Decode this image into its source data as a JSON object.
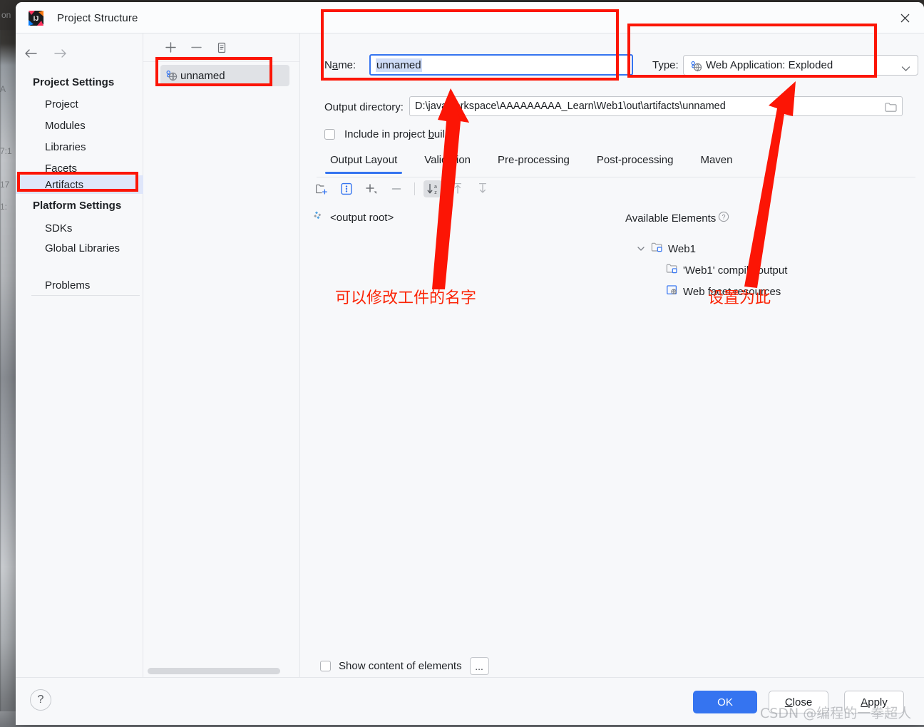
{
  "window": {
    "title": "Project Structure",
    "close_label": "✕"
  },
  "sidebar": {
    "nav_back": "back-arrow",
    "nav_forward": "forward-arrow",
    "groups": [
      {
        "header": "Project Settings",
        "items": [
          {
            "label": "Project",
            "selected": false
          },
          {
            "label": "Modules",
            "selected": false
          },
          {
            "label": "Libraries",
            "selected": false
          },
          {
            "label": "Facets",
            "selected": false
          },
          {
            "label": "Artifacts",
            "selected": true
          }
        ]
      },
      {
        "header": "Platform Settings",
        "items": [
          {
            "label": "SDKs",
            "selected": false
          },
          {
            "label": "Global Libraries",
            "selected": false
          }
        ]
      }
    ],
    "problems_label": "Problems"
  },
  "artifact_list": {
    "toolbar": [
      {
        "name": "add-icon",
        "glyph": "+"
      },
      {
        "name": "remove-icon",
        "glyph": "–"
      },
      {
        "name": "copy-icon",
        "glyph": "copy"
      }
    ],
    "items": [
      {
        "label": "unnamed",
        "icon": "web-artifact-icon",
        "selected": true
      }
    ]
  },
  "main": {
    "name_label": "Name:",
    "name_label_prefix": "N",
    "name_label_mnemonic": "a",
    "name_label_suffix": "me:",
    "name_value": "unnamed",
    "type_label": "Type:",
    "type_value": "Web Application: Exploded",
    "type_icon": "web-artifact-icon",
    "output_label": "Output directory:",
    "output_value": "D:\\javaworkspace\\AAAAAAAAA_Learn\\Web1\\out\\artifacts\\unnamed",
    "include_checkbox": {
      "label_prefix": "Include in project ",
      "label_mnemonic": "b",
      "label_suffix": "uild",
      "checked": false
    },
    "tabs": [
      {
        "label": "Output Layout",
        "active": true
      },
      {
        "label": "Validation",
        "active": false
      },
      {
        "label": "Pre-processing",
        "active": false
      },
      {
        "label": "Post-processing",
        "active": false
      },
      {
        "label": "Maven",
        "active": false
      }
    ],
    "layout_toolbar": [
      {
        "name": "new-directory-icon",
        "pressed": false
      },
      {
        "name": "new-archive-icon",
        "pressed": false
      },
      {
        "name": "add-dropdown-icon",
        "pressed": false
      },
      {
        "name": "remove-icon",
        "pressed": false
      },
      {
        "name": "sort-alphabetically-icon",
        "pressed": true
      },
      {
        "name": "move-up-icon",
        "pressed": false
      },
      {
        "name": "move-down-icon",
        "pressed": false
      }
    ],
    "output_root_label": "<output root>",
    "available_elements": {
      "title": "Available Elements",
      "help_glyph": "?",
      "tree": [
        {
          "label": "Web1",
          "icon": "module-icon",
          "depth": 0,
          "expanded": true
        },
        {
          "label": "'Web1' compile output",
          "icon": "module-icon",
          "depth": 1
        },
        {
          "label": "Web facet resources",
          "icon": "web-facet-icon",
          "depth": 1
        }
      ]
    },
    "show_content": {
      "label": "Show content of elements",
      "checked": false,
      "more_label": "..."
    }
  },
  "footer": {
    "help_glyph": "?",
    "buttons": [
      {
        "label": "OK",
        "kind": "primary"
      },
      {
        "label": "Close",
        "kind": "default",
        "mnemonic": "C"
      },
      {
        "label": "Apply",
        "kind": "default",
        "mnemonic": "A"
      }
    ]
  },
  "annotations": {
    "note_name": "可以修改工件的名字",
    "note_type": "设置为此",
    "color": "#fc1505"
  },
  "watermark": "CSDN @编程的一拳超人"
}
